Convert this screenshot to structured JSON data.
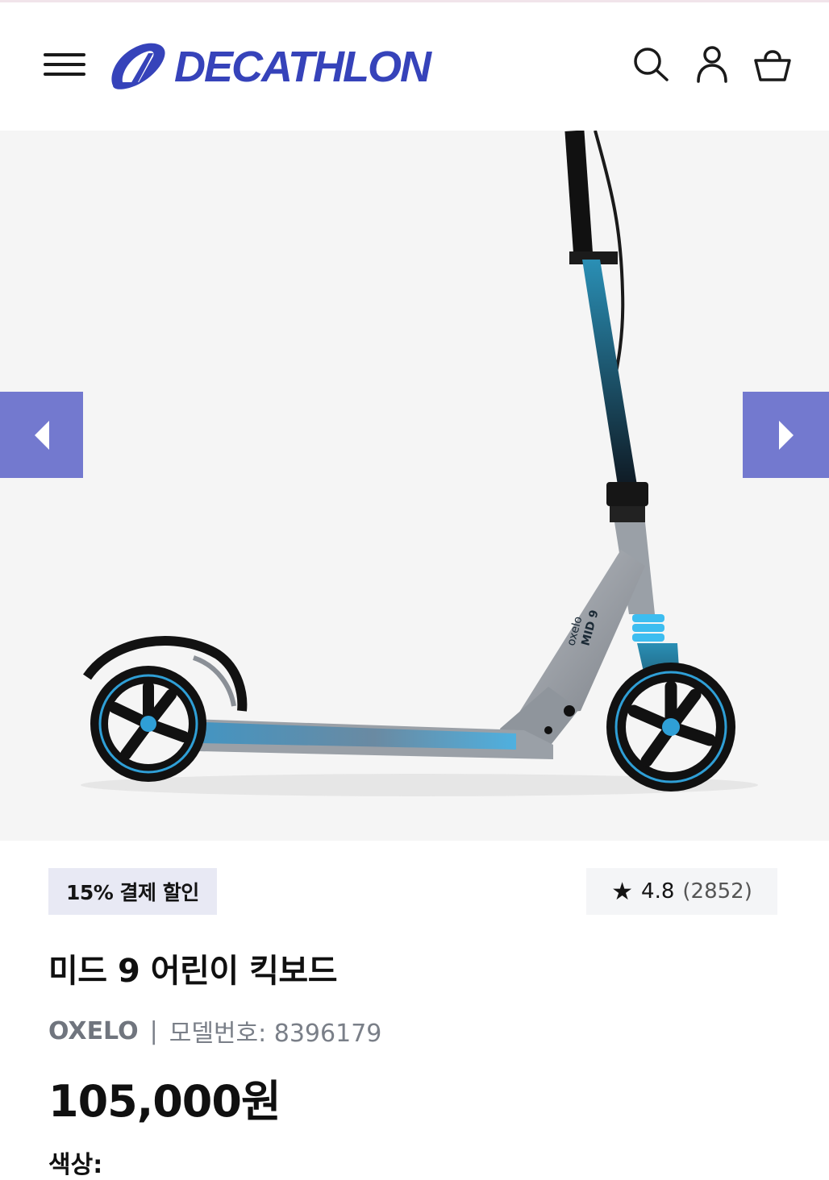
{
  "header": {
    "brand": "DECATHLON",
    "brand_color": "#3643ba",
    "icons": [
      "menu-icon",
      "search-icon",
      "user-icon",
      "basket-icon"
    ]
  },
  "gallery": {
    "background": "#f5f5f5",
    "arrow_color": "#7379cf",
    "prev_icon": "chevron-left-icon",
    "next_icon": "chevron-right-icon",
    "scooter_stem_text": "oxelo",
    "scooter_model_text": "MID 9"
  },
  "product": {
    "discount_badge": "15% 결제 할인",
    "rating_star": "★",
    "rating_value": "4.8",
    "rating_count": "(2852)",
    "title": "미드 9 어린이 킥보드",
    "brand": "OXELO",
    "separator": "|",
    "model_label": "모델번호: 8396179",
    "price": "105,000원",
    "color_label": "색상:"
  }
}
